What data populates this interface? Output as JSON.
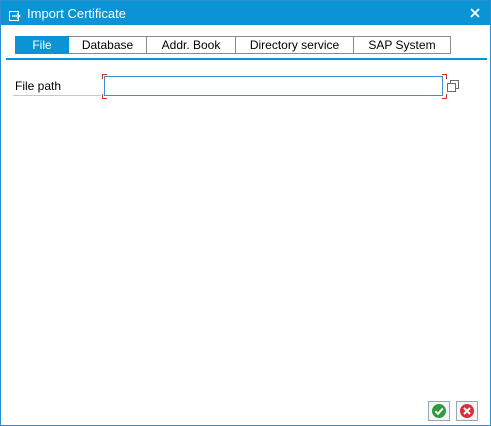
{
  "window": {
    "title": "Import Certificate",
    "title_icon": "import-certificate-icon",
    "close_icon": "close-icon",
    "accent_color": "#0a94d6"
  },
  "tabs": [
    {
      "label": "File",
      "active": true
    },
    {
      "label": "Database",
      "active": false
    },
    {
      "label": "Addr. Book",
      "active": false
    },
    {
      "label": "Directory service",
      "active": false
    },
    {
      "label": "SAP System",
      "active": false
    }
  ],
  "form": {
    "file_path_label": "File path",
    "file_path_value": "",
    "value_help_icon": "value-help-icon"
  },
  "footer": {
    "ok_icon": "checkmark-icon",
    "ok_color": "#2e9b3e",
    "cancel_icon": "cancel-x-icon",
    "cancel_color": "#d6323c"
  }
}
